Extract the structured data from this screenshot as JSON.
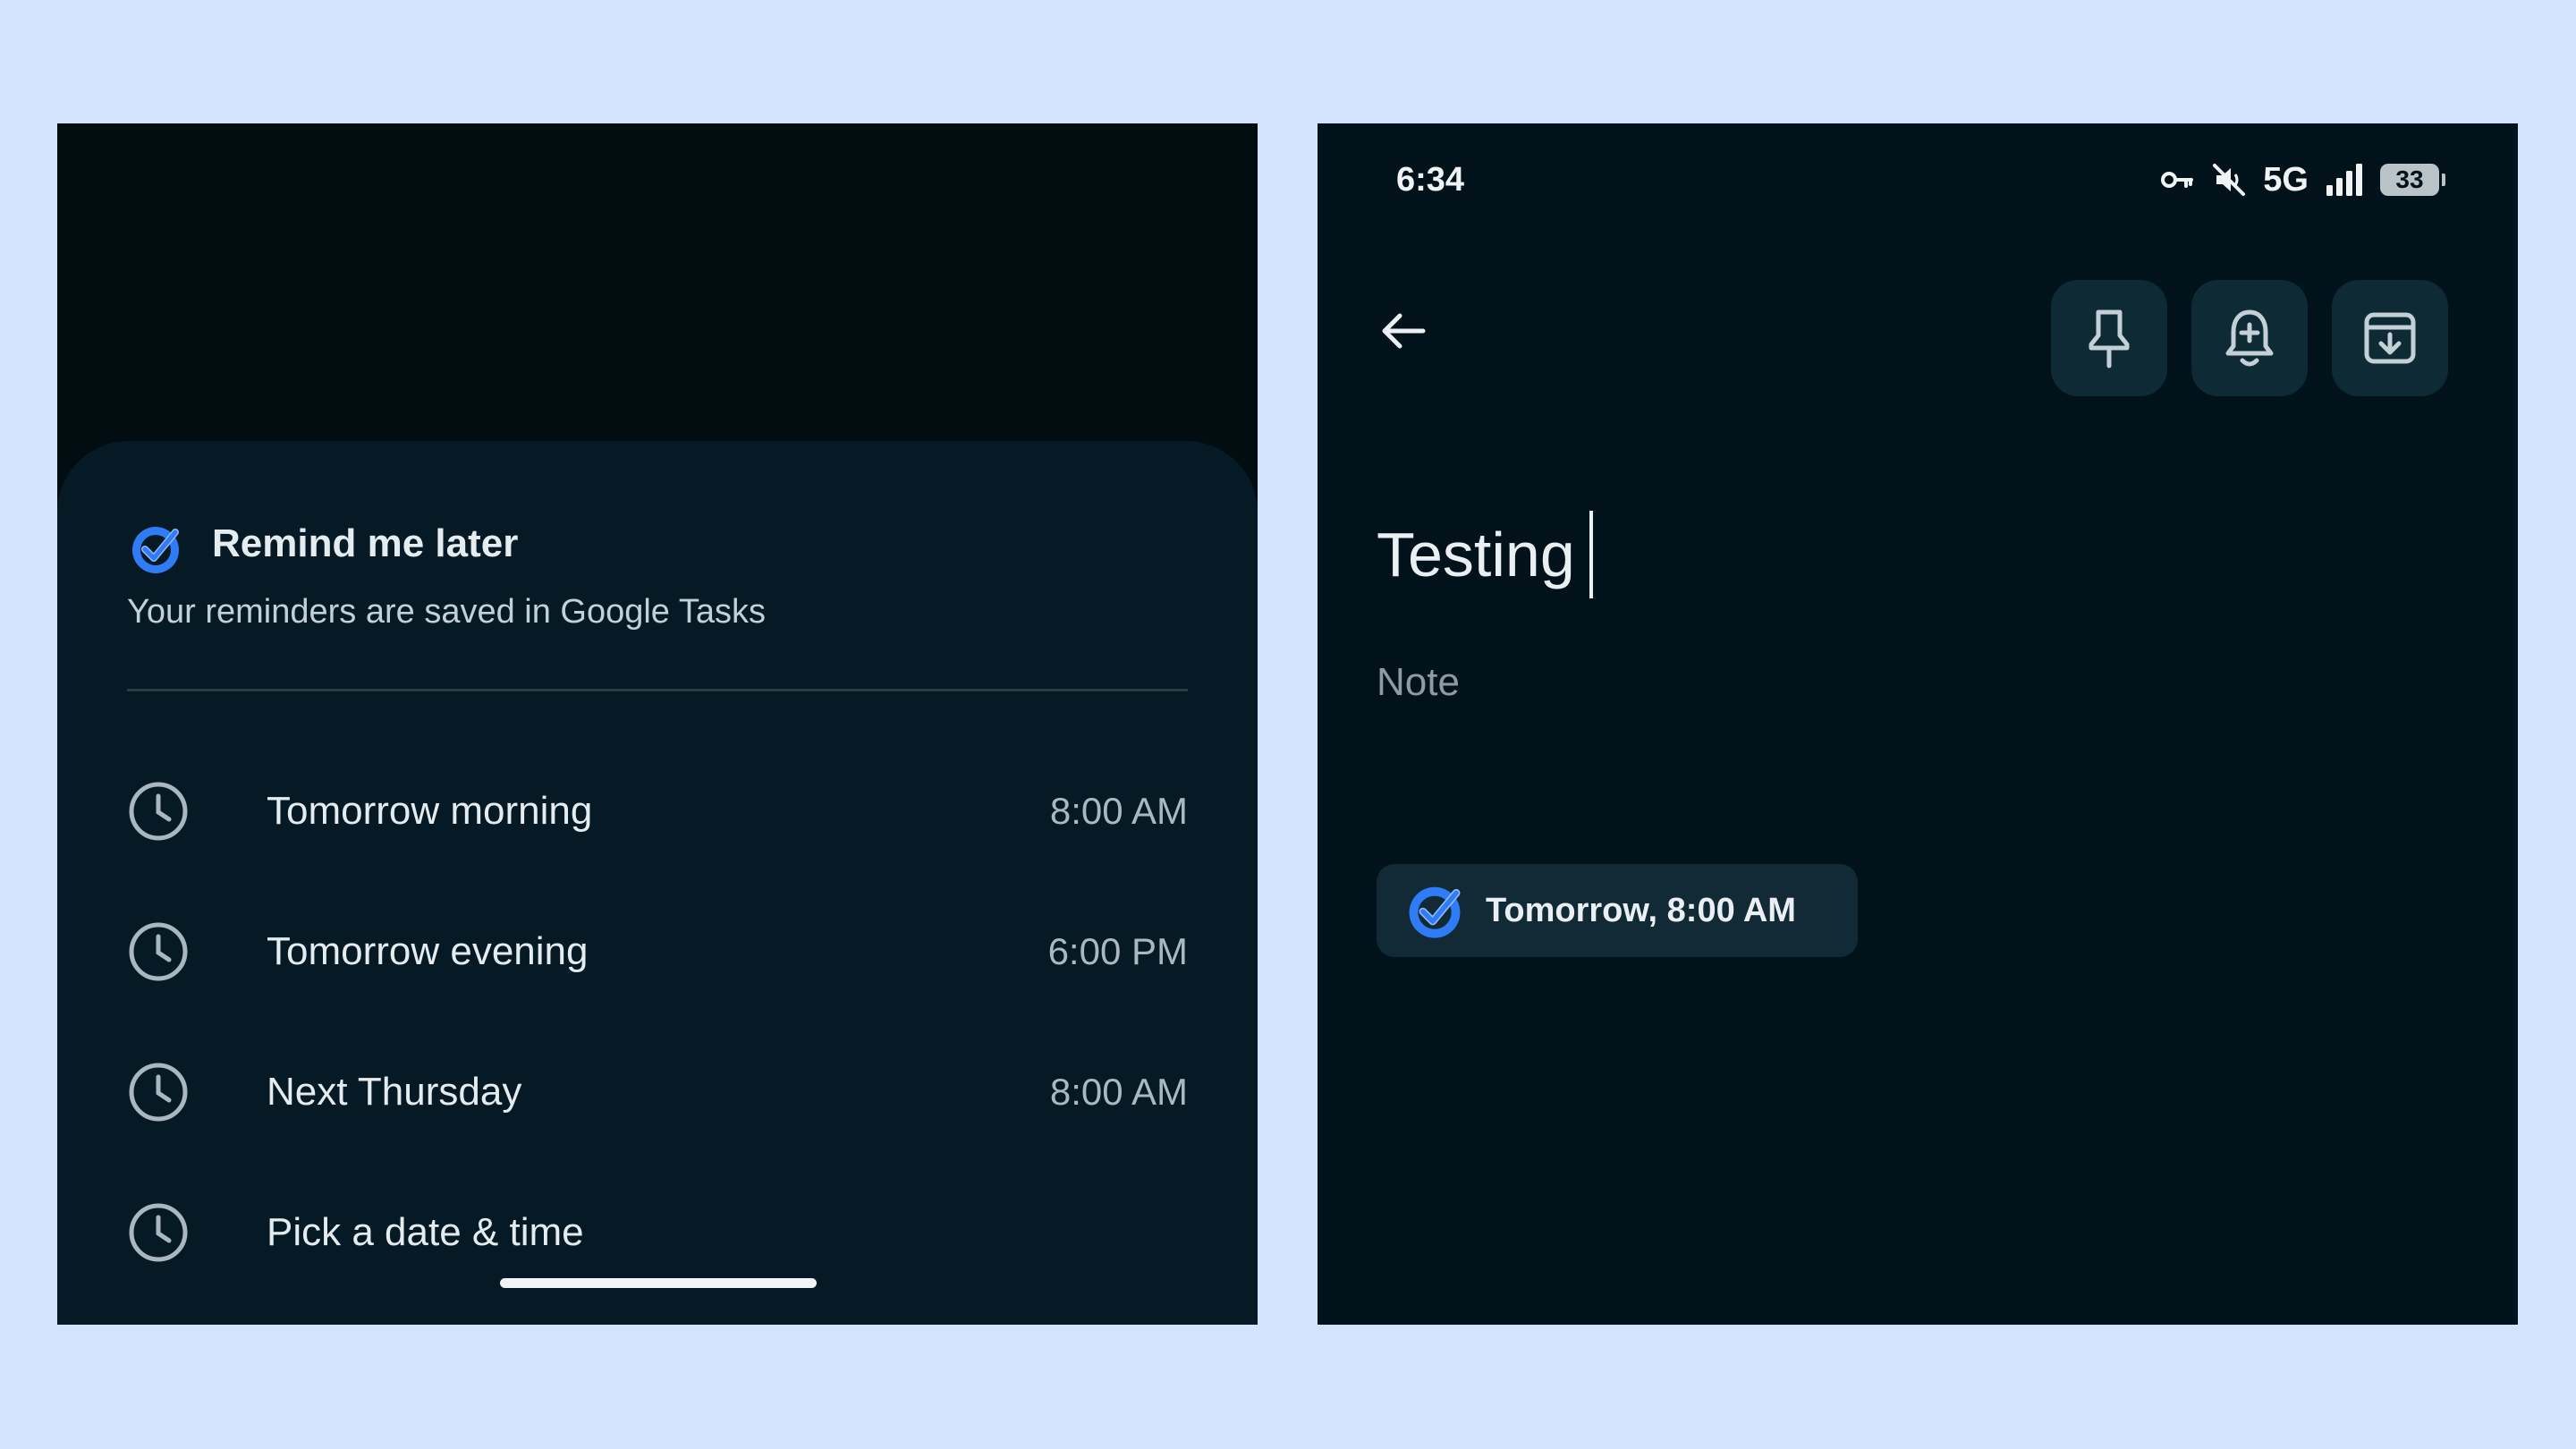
{
  "left_panel": {
    "sheet": {
      "title": "Remind me later",
      "subtitle": "Your reminders are saved in Google Tasks",
      "options": [
        {
          "label": "Tomorrow morning",
          "time": "8:00 AM",
          "icon": "clock-icon"
        },
        {
          "label": "Tomorrow evening",
          "time": "6:00 PM",
          "icon": "clock-icon"
        },
        {
          "label": "Next Thursday",
          "time": "8:00 AM",
          "icon": "clock-icon"
        },
        {
          "label": "Pick a date & time",
          "time": "",
          "icon": "clock-icon"
        }
      ]
    }
  },
  "right_panel": {
    "status_bar": {
      "time": "6:34",
      "network": "5G",
      "battery": "33"
    },
    "toolbar": {
      "back_icon": "arrow-back-icon",
      "actions": [
        "pin-icon",
        "add-reminder-icon",
        "archive-icon"
      ]
    },
    "note": {
      "title": "Testing",
      "body_placeholder": "Note",
      "reminder_chip": "Tomorrow, 8:00 AM"
    }
  },
  "colors": {
    "background": "#d3e3fd",
    "panel": "#020d12",
    "sheet": "#051a24",
    "accent_blue": "#2f7cf6",
    "text_primary": "#e4ecf0"
  }
}
